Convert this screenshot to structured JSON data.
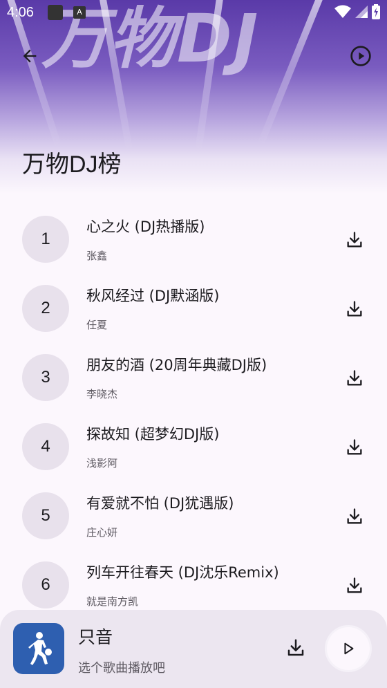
{
  "status_bar": {
    "time": "4:06"
  },
  "header": {
    "banner_art_text": "万物DJ",
    "back_icon": "arrow-back-icon",
    "play_icon": "play-circle-icon",
    "title": "万物DJ榜"
  },
  "songs": [
    {
      "rank": "1",
      "title": "心之火 (DJ热播版)",
      "artist": "张鑫"
    },
    {
      "rank": "2",
      "title": "秋风经过 (DJ默涵版)",
      "artist": "任夏"
    },
    {
      "rank": "3",
      "title": "朋友的酒 (20周年典藏DJ版)",
      "artist": "李晓杰"
    },
    {
      "rank": "4",
      "title": "探故知 (超梦幻DJ版)",
      "artist": "浅影阿"
    },
    {
      "rank": "5",
      "title": "有爱就不怕 (DJ犹遇版)",
      "artist": "庄心妍"
    },
    {
      "rank": "6",
      "title": "列车开往春天 (DJ沈乐Remix)",
      "artist": "就是南方凯"
    }
  ],
  "player": {
    "title": "只音",
    "subtitle": "选个歌曲播放吧",
    "download_icon": "download-icon",
    "play_icon": "play-icon"
  },
  "colors": {
    "background": "#fcf7fd",
    "rank_badge": "#e8e1ec",
    "player_bar": "#ece6f0",
    "cover": "#2e5fb0",
    "hero_purple": "#5a3aa8"
  }
}
